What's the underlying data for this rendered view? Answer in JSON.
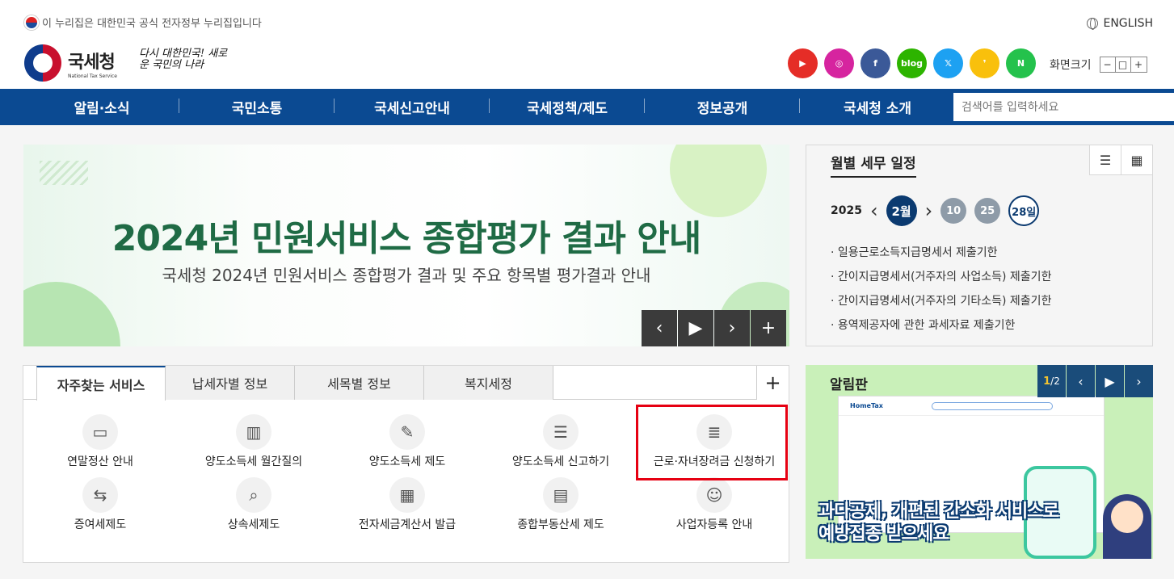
{
  "top": {
    "gov_notice": "이 누리집은 대한민국 공식 전자정부 누리집입니다",
    "english": "ENGLISH",
    "logo_kr": "국세청",
    "logo_en": "National Tax Service",
    "slogan": "다시 대한민국! 새로운 국민의 나라",
    "sns": [
      {
        "name": "youtube",
        "label": "▶",
        "color": "#e52d27"
      },
      {
        "name": "instagram",
        "label": "◎",
        "color": "#d6249f"
      },
      {
        "name": "facebook",
        "label": "f",
        "color": "#3b5998"
      },
      {
        "name": "blog",
        "label": "blog",
        "color": "#2db400"
      },
      {
        "name": "x",
        "label": "𝕏",
        "color": "#1da1f2"
      },
      {
        "name": "kakao-story",
        "label": "❜",
        "color": "#f9c00c"
      },
      {
        "name": "naver-post",
        "label": "N",
        "color": "#24c24c"
      }
    ],
    "screen_size_label": "화면크기",
    "screen_size_buttons": [
      "−",
      "□",
      "+"
    ]
  },
  "gnb": {
    "items": [
      "알림·소식",
      "국민소통",
      "국세신고안내",
      "국세정책/제도",
      "정보공개",
      "국세청 소개"
    ],
    "search_placeholder": "검색어를 입력하세요"
  },
  "banner": {
    "title": "2024년 민원서비스 종합평가 결과 안내",
    "subtitle": "국세청 2024년 민원서비스 종합평가 결과 및 주요 항목별 평가결과 안내",
    "controls": [
      "‹",
      "▶",
      "›",
      "+"
    ]
  },
  "schedule": {
    "title": "월별 세무 일정",
    "year": "2025",
    "month": "2월",
    "days": [
      "10",
      "25",
      "28일"
    ],
    "items": [
      "· 일용근로소득지급명세서 제출기한",
      "· 간이지급명세서(거주자의 사업소득) 제출기한",
      "· 간이지급명세서(거주자의 기타소득) 제출기한",
      "· 용역제공자에 관한 과세자료 제출기한"
    ]
  },
  "services": {
    "tabs": [
      "자주찾는 서비스",
      "납세자별 정보",
      "세목별 정보",
      "복지세정"
    ],
    "plus": "+",
    "items": [
      {
        "label": "연말정산 안내",
        "icon": "monitor-book-icon",
        "glyph": "▭"
      },
      {
        "label": "양도소득세 월간질의",
        "icon": "building-icon",
        "glyph": "▥"
      },
      {
        "label": "양도소득세 제도",
        "icon": "document-pen-icon",
        "glyph": "✎"
      },
      {
        "label": "양도소득세 신고하기",
        "icon": "form-icon",
        "glyph": "☰"
      },
      {
        "label": "근로·자녀장려금 신청하기",
        "icon": "report-icon",
        "glyph": "≣"
      },
      {
        "label": "증여세제도",
        "icon": "people-exchange-icon",
        "glyph": "⇆"
      },
      {
        "label": "상속세제도",
        "icon": "laptop-search-icon",
        "glyph": "⌕"
      },
      {
        "label": "전자세금계산서 발급",
        "icon": "calculator-icon",
        "glyph": "▦"
      },
      {
        "label": "종합부동산세 제도",
        "icon": "files-icon",
        "glyph": "▤"
      },
      {
        "label": "사업자등록 안내",
        "icon": "id-card-icon",
        "glyph": "☺"
      }
    ]
  },
  "notice": {
    "title": "알림판",
    "page_current": "1",
    "page_total": "/2",
    "controls": [
      "‹",
      "▶",
      "›"
    ],
    "caption_line1": "과다공제, 개편된 간소화 서비스로",
    "caption_line2": "예방접종 받으세요",
    "screen_logo": "HomeTax"
  }
}
